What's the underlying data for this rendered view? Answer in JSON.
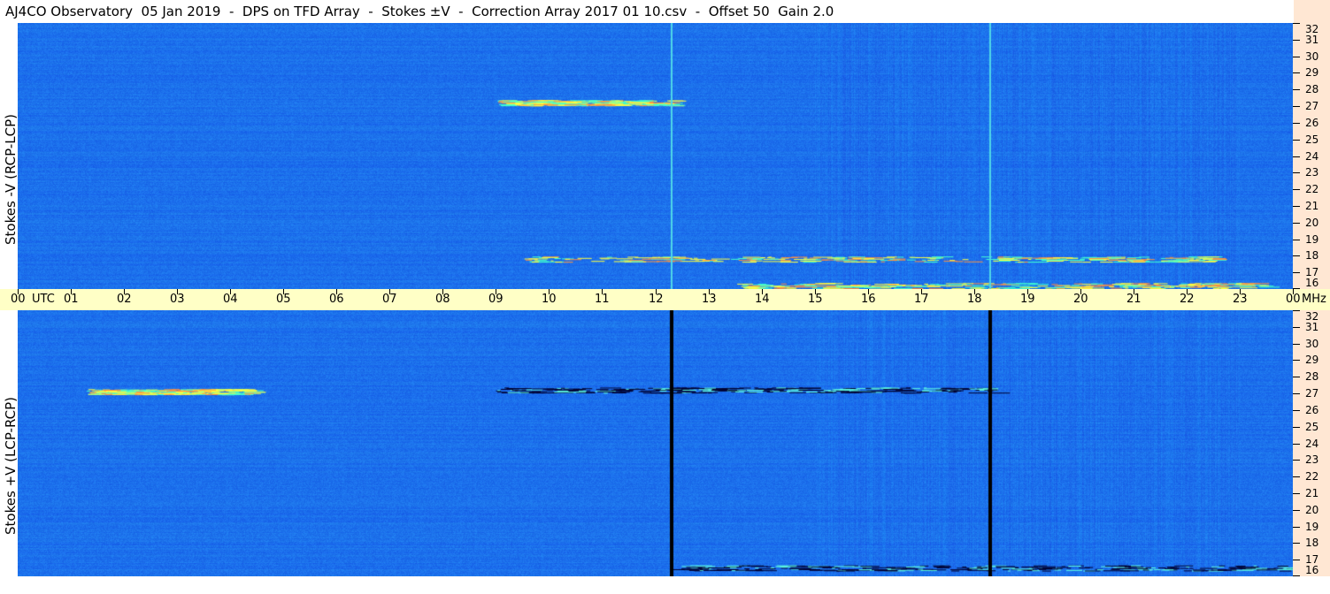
{
  "title": "AJ4CO Observatory  05 Jan 2019  -  DPS on TFD Array  -  Stokes ±V  -  Correction Array 2017 01 10.csv  -  Offset 50  Gain 2.0",
  "panels": [
    {
      "id": "top",
      "ylabel": "Stokes -V (RCP-LCP)"
    },
    {
      "id": "bottom",
      "ylabel": "Stokes +V (LCP-RCP)"
    }
  ],
  "chart_data": {
    "type": "heatmap",
    "title": "AJ4CO Observatory  05 Jan 2019  -  DPS on TFD Array  -  Stokes ±V  -  Correction Array 2017 01 10.csv  -  Offset 50  Gain 2.0",
    "x_axis": {
      "unit_label": "UTC",
      "range_hours": [
        0,
        24
      ],
      "tick_labels": [
        "00",
        "01",
        "02",
        "03",
        "04",
        "05",
        "06",
        "07",
        "08",
        "09",
        "10",
        "11",
        "12",
        "13",
        "14",
        "15",
        "16",
        "17",
        "18",
        "19",
        "20",
        "21",
        "22",
        "23",
        "00"
      ]
    },
    "y_axis": {
      "unit_label": "MHz",
      "range_mhz": [
        16,
        32
      ],
      "tick_labels": [
        "16",
        "17",
        "18",
        "19",
        "20",
        "21",
        "22",
        "23",
        "24",
        "25",
        "26",
        "27",
        "28",
        "29",
        "30",
        "31",
        "32"
      ]
    },
    "panels": [
      {
        "ylabel": "Stokes -V (RCP-LCP)"
      },
      {
        "ylabel": "Stokes +V (LCP-RCP)"
      }
    ],
    "colors": {
      "background": "#1c6ff0",
      "bright": "#ffff40",
      "dark": "#000030",
      "time_bar": "#ffffc6",
      "freq_axis": "#ffe7d3"
    },
    "vertical_markers_utc": [
      12.3,
      18.3
    ],
    "features": [
      {
        "panel": "top",
        "freq_mhz": 27.2,
        "utc_start": 9.0,
        "utc_end": 12.3,
        "intensity": "bright"
      },
      {
        "panel": "top",
        "freq_mhz": 17.8,
        "utc_start": 9.5,
        "utc_end": 22.5,
        "intensity": "bright"
      },
      {
        "panel": "top",
        "freq_mhz": 16.2,
        "utc_start": 13.5,
        "utc_end": 23.5,
        "intensity": "bright"
      },
      {
        "panel": "bottom",
        "freq_mhz": 27.1,
        "utc_start": 1.3,
        "utc_end": 4.3,
        "intensity": "bright"
      },
      {
        "panel": "bottom",
        "freq_mhz": 27.2,
        "utc_start": 9.0,
        "utc_end": 18.3,
        "intensity": "dark"
      },
      {
        "panel": "bottom",
        "freq_mhz": 16.5,
        "utc_start": 12.3,
        "utc_end": 24.0,
        "intensity": "dark"
      }
    ]
  }
}
